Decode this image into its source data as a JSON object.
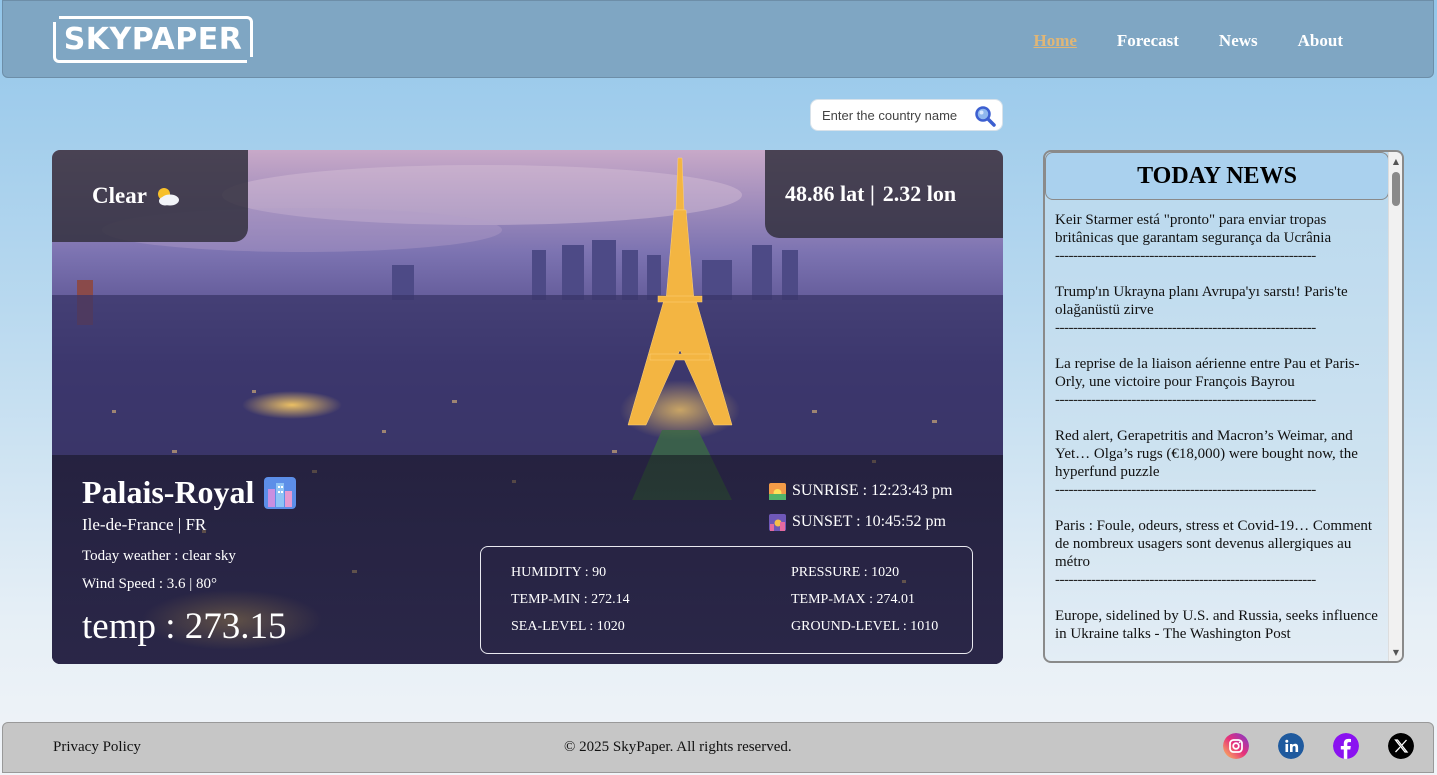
{
  "header": {
    "logo": "SKYPAPER",
    "nav": [
      {
        "label": "Home",
        "active": true
      },
      {
        "label": "Forecast"
      },
      {
        "label": "News"
      },
      {
        "label": "About"
      }
    ]
  },
  "search": {
    "placeholder": "Enter the country name",
    "icon": "search-icon"
  },
  "weather": {
    "condition": "Clear",
    "condition_icon": "sun-behind-cloud-icon",
    "lat": "48.86 lat |",
    "lon": "2.32 lon",
    "city": "Palais-Royal",
    "city_icon": "cityscape-icon",
    "region": "Ile-de-France | FR",
    "description": "Today weather : clear sky",
    "wind": "Wind Speed : 3.6 | 80°",
    "temp": "temp : 273.15",
    "sunrise": "SUNRISE : 12:23:43 pm",
    "sunset": "SUNSET : 10:45:52 pm",
    "stats": {
      "humidity": "HUMIDITY : 90",
      "pressure": "PRESSURE : 1020",
      "temp_min": "TEMP-MIN : 272.14",
      "temp_max": "TEMP-MAX : 274.01",
      "sea_level": "SEA-LEVEL : 1020",
      "ground_level": "GROUND-LEVEL : 1010"
    }
  },
  "news": {
    "title": "TODAY NEWS",
    "separator": "----------------------------------------------------------",
    "items": [
      "Keir Starmer está \"pronto\" para enviar tropas britânicas que garantam segurança da Ucrânia",
      "Trump'ın Ukrayna planı Avrupa'yı sarstı! Paris'te olağanüstü zirve",
      "La reprise de la liaison aérienne entre Pau et Paris-Orly, une victoire pour François Bayrou",
      "Red alert, Gerapetritis and Macron’s Weimar, and Yet… Olga’s rugs (€18,000) were bought now, the hyperfund puzzle",
      "Paris : Foule, odeurs, stress et Covid-19… Comment de nombreux usagers sont devenus allergiques au métro",
      "Europe, sidelined by U.S. and Russia, seeks influence in Ukraine talks - The Washington Post"
    ]
  },
  "footer": {
    "privacy": "Privacy Policy",
    "copyright": "© 2025 SkyPaper. All rights reserved.",
    "social": [
      "instagram-icon",
      "linkedin-icon",
      "facebook-icon",
      "x-icon"
    ]
  }
}
